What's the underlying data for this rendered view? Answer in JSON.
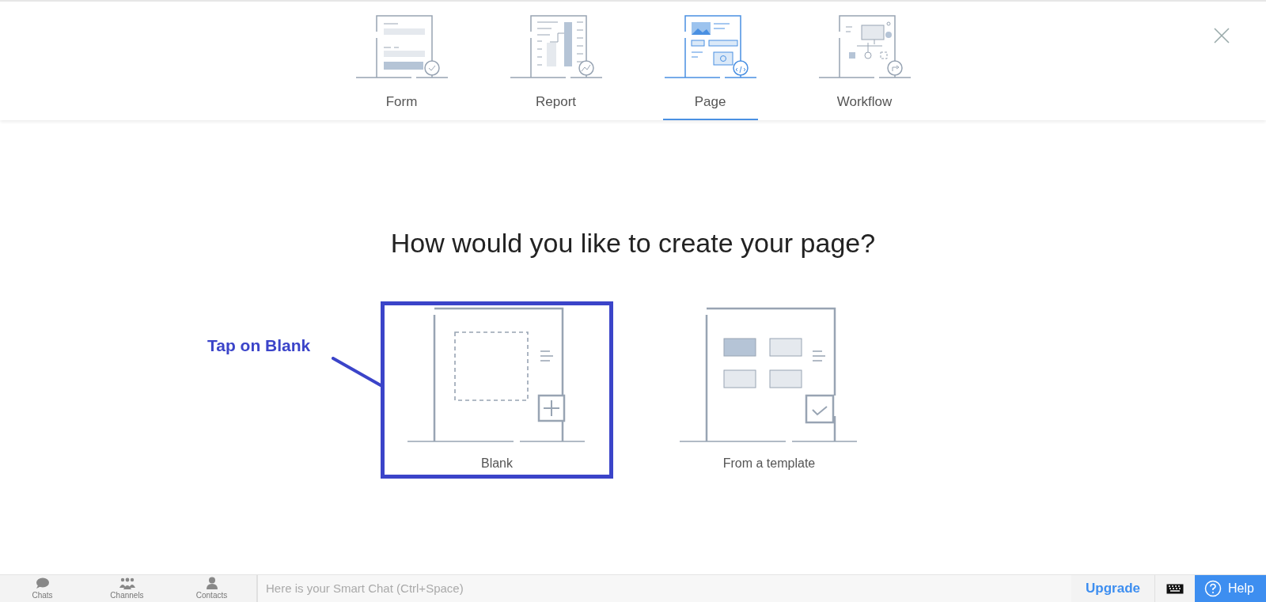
{
  "tabs": [
    {
      "label": "Form",
      "selected": false
    },
    {
      "label": "Report",
      "selected": false
    },
    {
      "label": "Page",
      "selected": true
    },
    {
      "label": "Workflow",
      "selected": false
    }
  ],
  "heading": "How would you like to create your page?",
  "options": [
    {
      "label": "Blank",
      "highlighted": true
    },
    {
      "label": "From a template",
      "highlighted": false
    }
  ],
  "annotation": {
    "text": "Tap on Blank"
  },
  "bottom_bar": {
    "nav": [
      {
        "label": "Chats"
      },
      {
        "label": "Channels"
      },
      {
        "label": "Contacts"
      }
    ],
    "chat_placeholder": "Here is your Smart Chat (Ctrl+Space)",
    "upgrade": "Upgrade",
    "help": "Help"
  }
}
